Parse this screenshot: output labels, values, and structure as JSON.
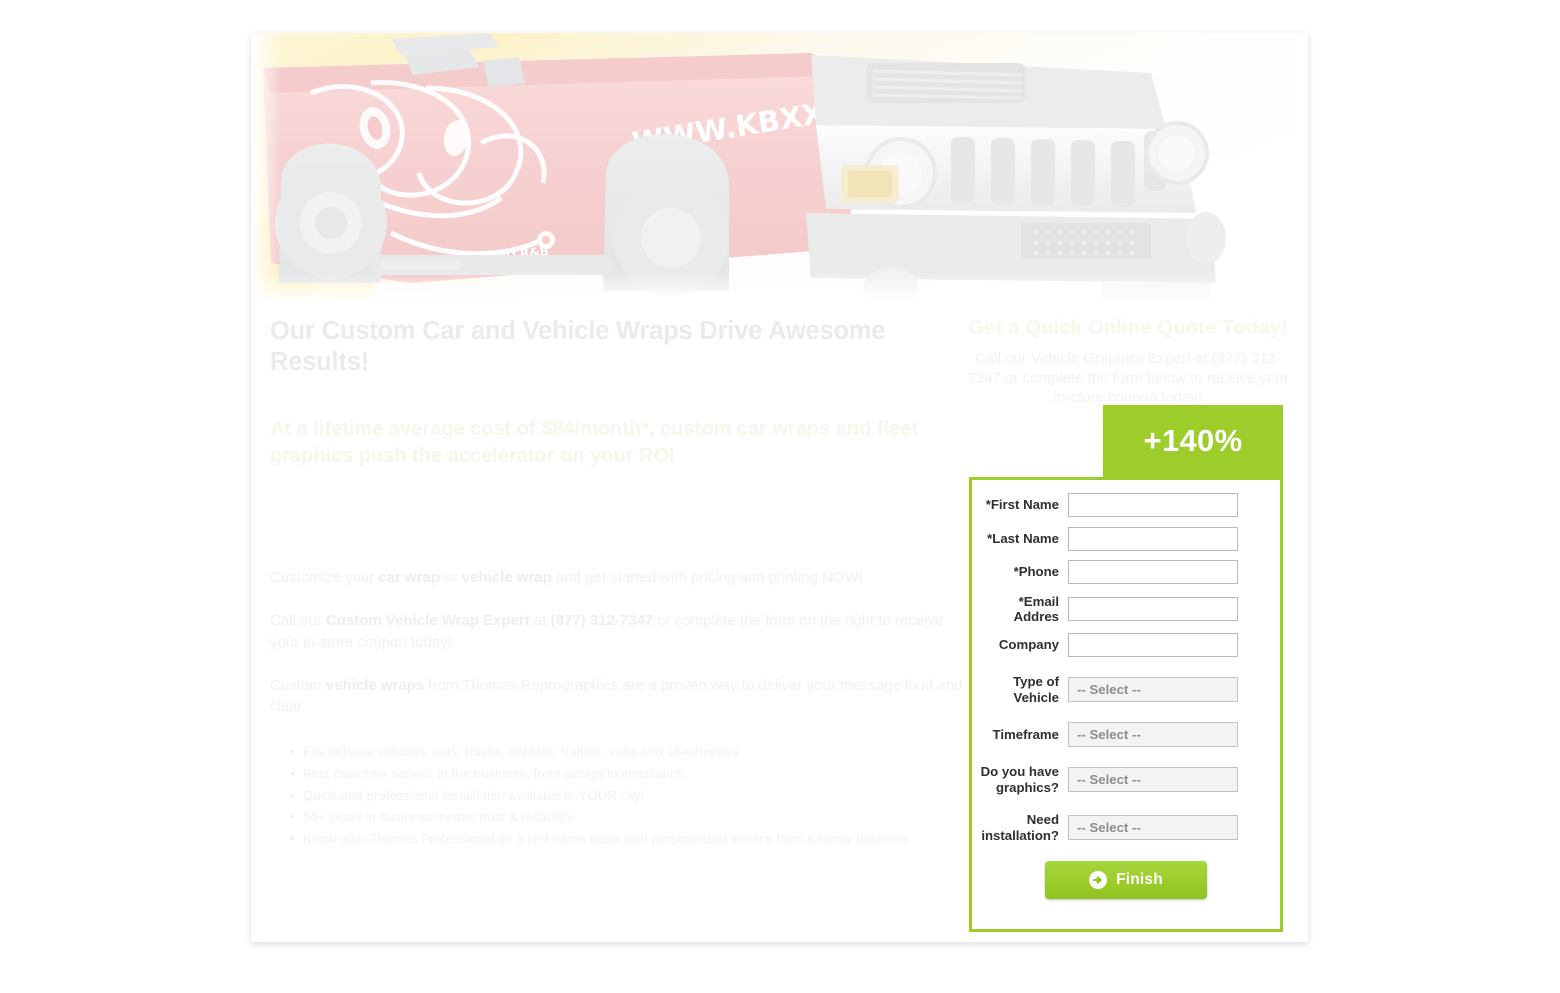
{
  "hero": {
    "alt": "Red Hummer H2 with custom white vehicle wrap graphics and chrome grille",
    "vehicle_wrap_text": "WWW.KBXX.COM"
  },
  "left": {
    "headline": "Our Custom Car and Vehicle Wraps Drive Awesome Results!",
    "subheadline": "At a lifetime average cost of $84/month*, custom car wraps and fleet graphics push the accelerator on your ROI",
    "paragraph1": {
      "part1": "Customize your ",
      "bold1": "car wrap",
      "part2": " or ",
      "bold2": "vehicle wrap",
      "part3": " and get started with pricing and printing NOW!"
    },
    "paragraph2": {
      "part1": "Call our ",
      "bold1": "Custom Vehicle Wrap Expert",
      "part2": " at ",
      "bold2": "(877) 312-7347",
      "part3": " or complete the form on the right to receive your in-store coupon today!"
    },
    "paragraph3": {
      "part1": "Custom ",
      "bold1": "vehicle wraps",
      "part2": " from Thomas Reprographics are a proven way to deliver your message loud and clear."
    },
    "bullets": [
      "Fits delivery vehicles, cars, trucks, bobtails, trailers, vans and 18-wheelers",
      "Best customer service in the business, from design to installation",
      "Quick and professional installation available in YOUR city!",
      "50+ years in business means trust & reliability",
      "Know your Thomas Professional on a first name basis with personalized service from a family business"
    ]
  },
  "right": {
    "title": "Get a Quick Online Quote Today!",
    "subtitle": "Call our Vehicle Graphics Expert at (877) 312-7347 or complete the form below to receive your in-store coupon today!"
  },
  "badge": {
    "text": "+140%"
  },
  "form": {
    "fields": [
      {
        "label": "*First Name",
        "type": "text",
        "value": "",
        "placeholder": ""
      },
      {
        "label": "*Last Name",
        "type": "text",
        "value": "",
        "placeholder": ""
      },
      {
        "label": "*Phone",
        "type": "text",
        "value": "",
        "placeholder": ""
      },
      {
        "label": "*Email Addres",
        "type": "text",
        "value": "",
        "placeholder": ""
      },
      {
        "label": "Company",
        "type": "text",
        "value": "",
        "placeholder": ""
      },
      {
        "label": "Type of Vehicle",
        "type": "select",
        "value": "-- Select --"
      },
      {
        "label": "Timeframe",
        "type": "select",
        "value": "-- Select --"
      },
      {
        "label": "Do you have graphics?",
        "type": "select",
        "value": "-- Select --"
      },
      {
        "label": "Need installation?",
        "type": "select",
        "value": "-- Select --"
      }
    ],
    "submit_label": "Finish",
    "submit_icon": "arrow-right-circle-icon"
  },
  "colors": {
    "brand_green": "#9CCD2B",
    "badge_green": "#9CCD2B",
    "text_dark": "#2F2F2F",
    "page_background": "#FFFFFF"
  }
}
